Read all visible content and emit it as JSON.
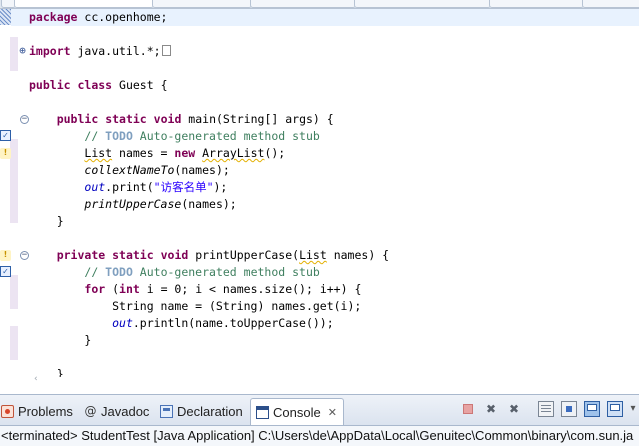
{
  "editor": {
    "lines": [
      {
        "segs": [
          {
            "t": "package",
            "c": "kw"
          },
          {
            "t": " cc.openhome;"
          }
        ]
      },
      {
        "segs": []
      },
      {
        "segs": [
          {
            "t": "import",
            "c": "kw"
          },
          {
            "t": " java.util.*;"
          }
        ],
        "collapsed": true
      },
      {
        "segs": []
      },
      {
        "segs": [
          {
            "t": "public",
            "c": "kw"
          },
          {
            "t": " "
          },
          {
            "t": "class",
            "c": "kw"
          },
          {
            "t": " Guest {"
          }
        ]
      },
      {
        "segs": []
      },
      {
        "segs": [
          {
            "t": "    "
          },
          {
            "t": "public",
            "c": "kw"
          },
          {
            "t": " "
          },
          {
            "t": "static",
            "c": "kw"
          },
          {
            "t": " "
          },
          {
            "t": "void",
            "c": "kw"
          },
          {
            "t": " main(String[] args) {"
          }
        ]
      },
      {
        "segs": [
          {
            "t": "        "
          },
          {
            "t": "// ",
            "c": "cm"
          },
          {
            "t": "TODO",
            "c": "todo"
          },
          {
            "t": " Auto-generated method stub",
            "c": "cm"
          }
        ]
      },
      {
        "segs": [
          {
            "t": "        "
          },
          {
            "t": "List",
            "c": "warnu"
          },
          {
            "t": " names = "
          },
          {
            "t": "new",
            "c": "kw"
          },
          {
            "t": " "
          },
          {
            "t": "ArrayList",
            "c": "warnu"
          },
          {
            "t": "();"
          }
        ]
      },
      {
        "segs": [
          {
            "t": "        "
          },
          {
            "t": "collextNameTo",
            "c": "it"
          },
          {
            "t": "(names);"
          }
        ]
      },
      {
        "segs": [
          {
            "t": "        "
          },
          {
            "t": "out",
            "c": "fld"
          },
          {
            "t": ".print("
          },
          {
            "t": "\"访客名单\"",
            "c": "st"
          },
          {
            "t": ");"
          }
        ]
      },
      {
        "segs": [
          {
            "t": "        "
          },
          {
            "t": "printUpperCase",
            "c": "it"
          },
          {
            "t": "(names);"
          }
        ]
      },
      {
        "segs": [
          {
            "t": "    }"
          }
        ]
      },
      {
        "segs": []
      },
      {
        "segs": [
          {
            "t": "    "
          },
          {
            "t": "private",
            "c": "kw"
          },
          {
            "t": " "
          },
          {
            "t": "static",
            "c": "kw"
          },
          {
            "t": " "
          },
          {
            "t": "void",
            "c": "kw"
          },
          {
            "t": " printUpperCase("
          },
          {
            "t": "List",
            "c": "warnu"
          },
          {
            "t": " names) {"
          }
        ]
      },
      {
        "segs": [
          {
            "t": "        "
          },
          {
            "t": "// ",
            "c": "cm"
          },
          {
            "t": "TODO",
            "c": "todo"
          },
          {
            "t": " Auto-generated method stub",
            "c": "cm"
          }
        ]
      },
      {
        "segs": [
          {
            "t": "        "
          },
          {
            "t": "for",
            "c": "kw"
          },
          {
            "t": " ("
          },
          {
            "t": "int",
            "c": "kw"
          },
          {
            "t": " i = 0; i < names.size(); i++) {"
          }
        ]
      },
      {
        "segs": [
          {
            "t": "            String name = (String) names.get(i);"
          }
        ]
      },
      {
        "segs": [
          {
            "t": "            "
          },
          {
            "t": "out",
            "c": "fld"
          },
          {
            "t": ".println(name.toUpperCase());"
          }
        ]
      },
      {
        "segs": [
          {
            "t": "        }"
          }
        ]
      },
      {
        "segs": []
      },
      {
        "segs": [
          {
            "t": "    }"
          }
        ]
      }
    ],
    "gutter_icons": [
      "task",
      "warning",
      "warning",
      "task"
    ]
  },
  "panel": {
    "tabs": [
      {
        "label": "Problems",
        "icon": "problems-icon"
      },
      {
        "label": "Javadoc",
        "icon": "at-icon"
      },
      {
        "label": "Declaration",
        "icon": "declaration-icon"
      },
      {
        "label": "Console",
        "icon": "console-icon",
        "active": true,
        "close": "✕"
      }
    ],
    "toolbar": {
      "terminate": "stop-icon",
      "remove": "remove-launch-icon",
      "remove_all": "remove-all-launches-icon",
      "scroll_lock": "scroll-lock-icon",
      "pin": "pin-console-icon",
      "display_selected": "display-selected-console-icon",
      "open_console": "open-console-icon",
      "menu": "view-menu-icon"
    },
    "status": "<terminated> StudentTest [Java Application] C:\\Users\\de\\AppData\\Local\\Genuitec\\Common\\binary\\com.sun.ja"
  },
  "colors": {
    "keyword": "#7f0055",
    "comment": "#3f7f5f",
    "string": "#2a00ff",
    "field": "#0000c0",
    "current_line": "#e8f2fe"
  }
}
